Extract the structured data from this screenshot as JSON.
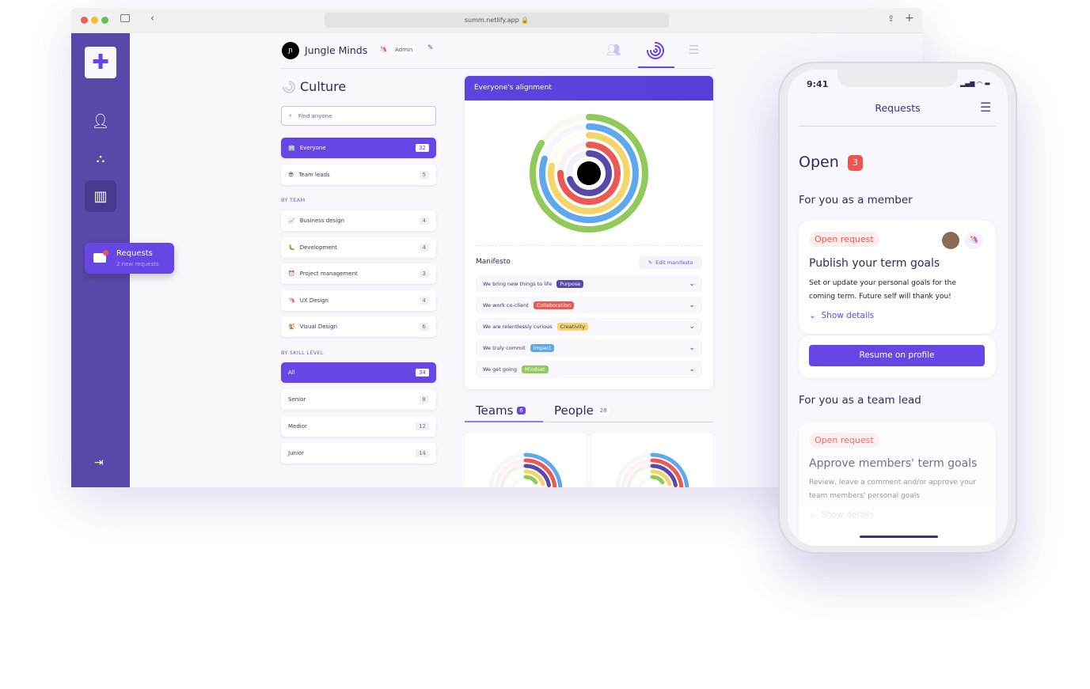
{
  "browser": {
    "url": "summ.netlify.app"
  },
  "sidebar": {
    "items": [
      {
        "icon": "person-icon"
      },
      {
        "icon": "network-icon"
      },
      {
        "icon": "building-icon",
        "active": true
      }
    ],
    "tooltip": {
      "title": "Requests",
      "subtitle": "2 new requests"
    },
    "logout_icon": "logout-icon"
  },
  "header": {
    "org": "Jungle Minds",
    "role": "Admin",
    "tabs": [
      {
        "icon": "people-icon"
      },
      {
        "icon": "rings-icon",
        "active": true
      },
      {
        "icon": "sliders-icon"
      }
    ]
  },
  "culture": {
    "title": "Culture",
    "search_placeholder": "Find anyone",
    "groups": [
      {
        "label": "Everyone",
        "count": "32",
        "emoji": "🏢",
        "active": true
      },
      {
        "label": "Team leads",
        "count": "5",
        "emoji": "😎"
      }
    ],
    "by_team_label": "BY TEAM",
    "teams": [
      {
        "label": "Business design",
        "count": "4",
        "emoji": "📈"
      },
      {
        "label": "Development",
        "count": "4",
        "emoji": "🐛"
      },
      {
        "label": "Project management",
        "count": "3",
        "emoji": "⏰"
      },
      {
        "label": "UX Design",
        "count": "4",
        "emoji": "🦄"
      },
      {
        "label": "Visual Design",
        "count": "6",
        "emoji": "🐒"
      }
    ],
    "by_skill_label": "BY SKILL LEVEL",
    "skills": [
      {
        "label": "All",
        "count": "34",
        "active": true
      },
      {
        "label": "Senior",
        "count": "8"
      },
      {
        "label": "Medior",
        "count": "12"
      },
      {
        "label": "Junior",
        "count": "14"
      }
    ]
  },
  "alignment": {
    "title": "Everyone's alignment",
    "rings": [
      {
        "color": "#8fca5b",
        "pct": 84
      },
      {
        "color": "#5fa8ee",
        "pct": 80
      },
      {
        "color": "#f4d56a",
        "pct": 78
      },
      {
        "color": "#ea5a52",
        "pct": 75
      },
      {
        "color": "#5a48a8",
        "pct": 70
      }
    ]
  },
  "manifesto": {
    "title": "Manifesto",
    "edit_label": "Edit manifesto",
    "rows": [
      {
        "text": "We bring new things to life",
        "tag": "Purpose",
        "color": "#5a48a8"
      },
      {
        "text": "We work co-client",
        "tag": "Collaboration",
        "color": "#ea5a52"
      },
      {
        "text": "We are relentlessly curious",
        "tag": "Creativity",
        "color": "#f4d56a"
      },
      {
        "text": "We truly commit",
        "tag": "Impact",
        "color": "#5fa8ee"
      },
      {
        "text": "We get going",
        "tag": "Mindset",
        "color": "#8fca5b"
      }
    ]
  },
  "tabs": {
    "teams": "Teams",
    "teams_count": "6",
    "people": "People",
    "people_count": "28"
  },
  "phone": {
    "time": "9:41",
    "title": "Requests",
    "open_label": "Open",
    "open_count": "3",
    "member_section": "For you as a member",
    "member_card": {
      "chip": "Open request",
      "title": "Publish your term goals",
      "desc": "Set or update your personal goals for the coming term. Future self will thank you!",
      "details": "Show details",
      "button": "Resume on profile"
    },
    "lead_section": "For you as a team lead",
    "lead_card": {
      "chip": "Open request",
      "title": "Approve members' term goals",
      "desc": "Review, leave a comment and/or approve your team members' personal goals",
      "details": "Show details"
    }
  }
}
